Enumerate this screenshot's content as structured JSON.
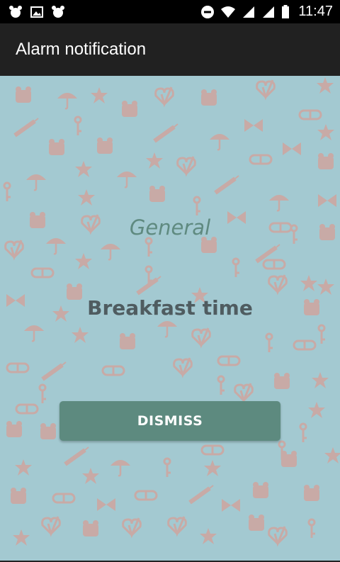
{
  "status_bar": {
    "time": "11:47",
    "left_icons": [
      "alarm-clock-icon",
      "image-icon",
      "alarm-clock-icon"
    ],
    "right_icons": [
      "do-not-disturb-icon",
      "wifi-icon",
      "signal-icon",
      "signal-icon",
      "battery-icon"
    ]
  },
  "app_bar": {
    "title": "Alarm notification"
  },
  "alarm": {
    "category": "General",
    "message": "Breakfast time",
    "dismiss_label": "DISMISS"
  },
  "colors": {
    "background": "#a3c9d1",
    "pattern": "#c8aaa6",
    "category_text": "#5f8a80",
    "message_text": "#4f5c60",
    "button": "#5d8a7f",
    "app_bar": "#212121"
  }
}
